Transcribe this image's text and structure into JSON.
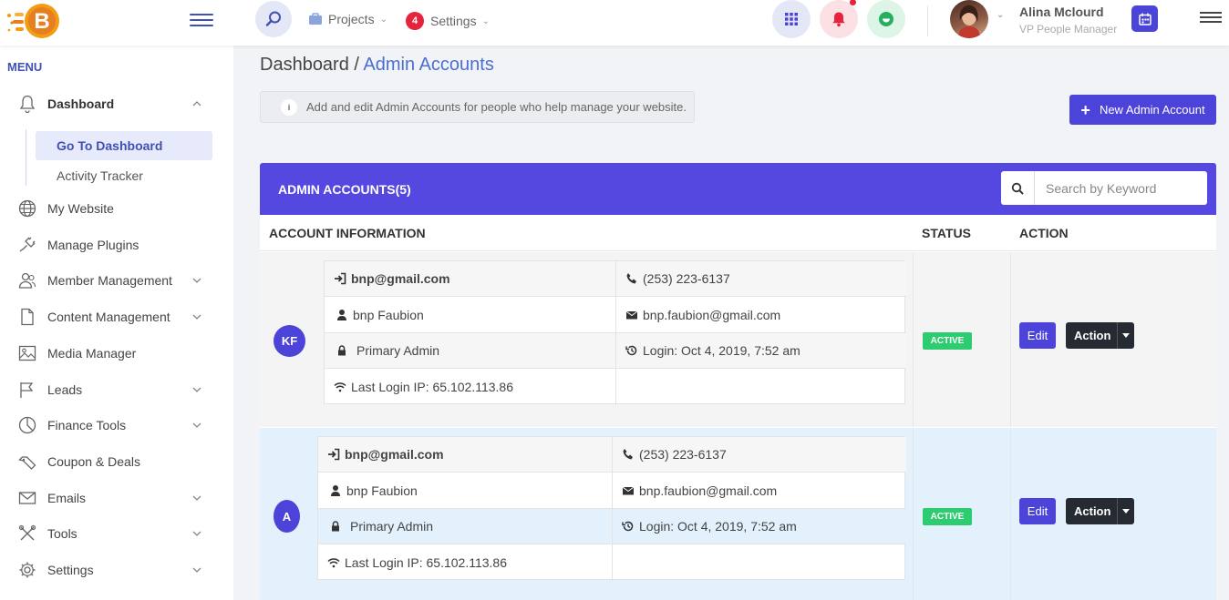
{
  "header": {
    "nav_projects": "Projects",
    "nav_settings": "Settings",
    "settings_badge": "4",
    "user_name": "Alina Mclourd",
    "user_role": "VP People Manager"
  },
  "sidebar": {
    "menu_title": "MENU",
    "items": [
      {
        "label": "Dashboard",
        "icon": "bell-icon"
      },
      {
        "label": "My Website",
        "icon": "globe-icon"
      },
      {
        "label": "Manage Plugins",
        "icon": "plug-icon"
      },
      {
        "label": "Member Management",
        "icon": "users-icon"
      },
      {
        "label": "Content Management",
        "icon": "file-icon"
      },
      {
        "label": "Media Manager",
        "icon": "image-icon"
      },
      {
        "label": "Leads",
        "icon": "flag-icon"
      },
      {
        "label": "Finance Tools",
        "icon": "pie-chart-icon"
      },
      {
        "label": "Coupon & Deals",
        "icon": "tag-icon"
      },
      {
        "label": "Emails",
        "icon": "mail-icon"
      },
      {
        "label": "Tools",
        "icon": "tools-icon"
      },
      {
        "label": "Settings",
        "icon": "gear-icon"
      }
    ],
    "sub_items": [
      "Go To Dashboard",
      "Activity Tracker"
    ]
  },
  "main": {
    "breadcrumb_root": "Dashboard",
    "breadcrumb_sep": "/",
    "breadcrumb_current": "Admin Accounts",
    "info_icon": "i",
    "info_text": "Add and edit Admin Accounts for people who help manage your website.",
    "new_button": "New Admin Account",
    "card_title": "ADMIN ACCOUNTS(5)",
    "search_placeholder": "Search by Keyword",
    "columns": [
      "ACCOUNT INFORMATION",
      "STATUS",
      "ACTION"
    ],
    "rows": [
      {
        "initials": "KF",
        "username": "bnp@gmail.com",
        "phone": "(253) 223-6137",
        "name": "bnp Faubion",
        "email": "bnp.faubion@gmail.com",
        "role": "Primary Admin",
        "login": "Login: Oct 4, 2019, 7:52 am",
        "ip": "Last Login IP: 65.102.113.86",
        "status": "ACTIVE",
        "edit": "Edit",
        "action": "Action"
      },
      {
        "initials": "A",
        "username": "bnp@gmail.com",
        "phone": "(253) 223-6137",
        "name": "bnp Faubion",
        "email": "bnp.faubion@gmail.com",
        "role": "Primary Admin",
        "login": "Login: Oct 4, 2019, 7:52 am",
        "ip": "Last Login IP: 65.102.113.86",
        "status": "ACTIVE",
        "edit": "Edit",
        "action": "Action"
      }
    ]
  },
  "colors": {
    "accent": "#4c44d9",
    "status_active": "#2ecc71",
    "row_highlight": "#e2f1fb"
  }
}
